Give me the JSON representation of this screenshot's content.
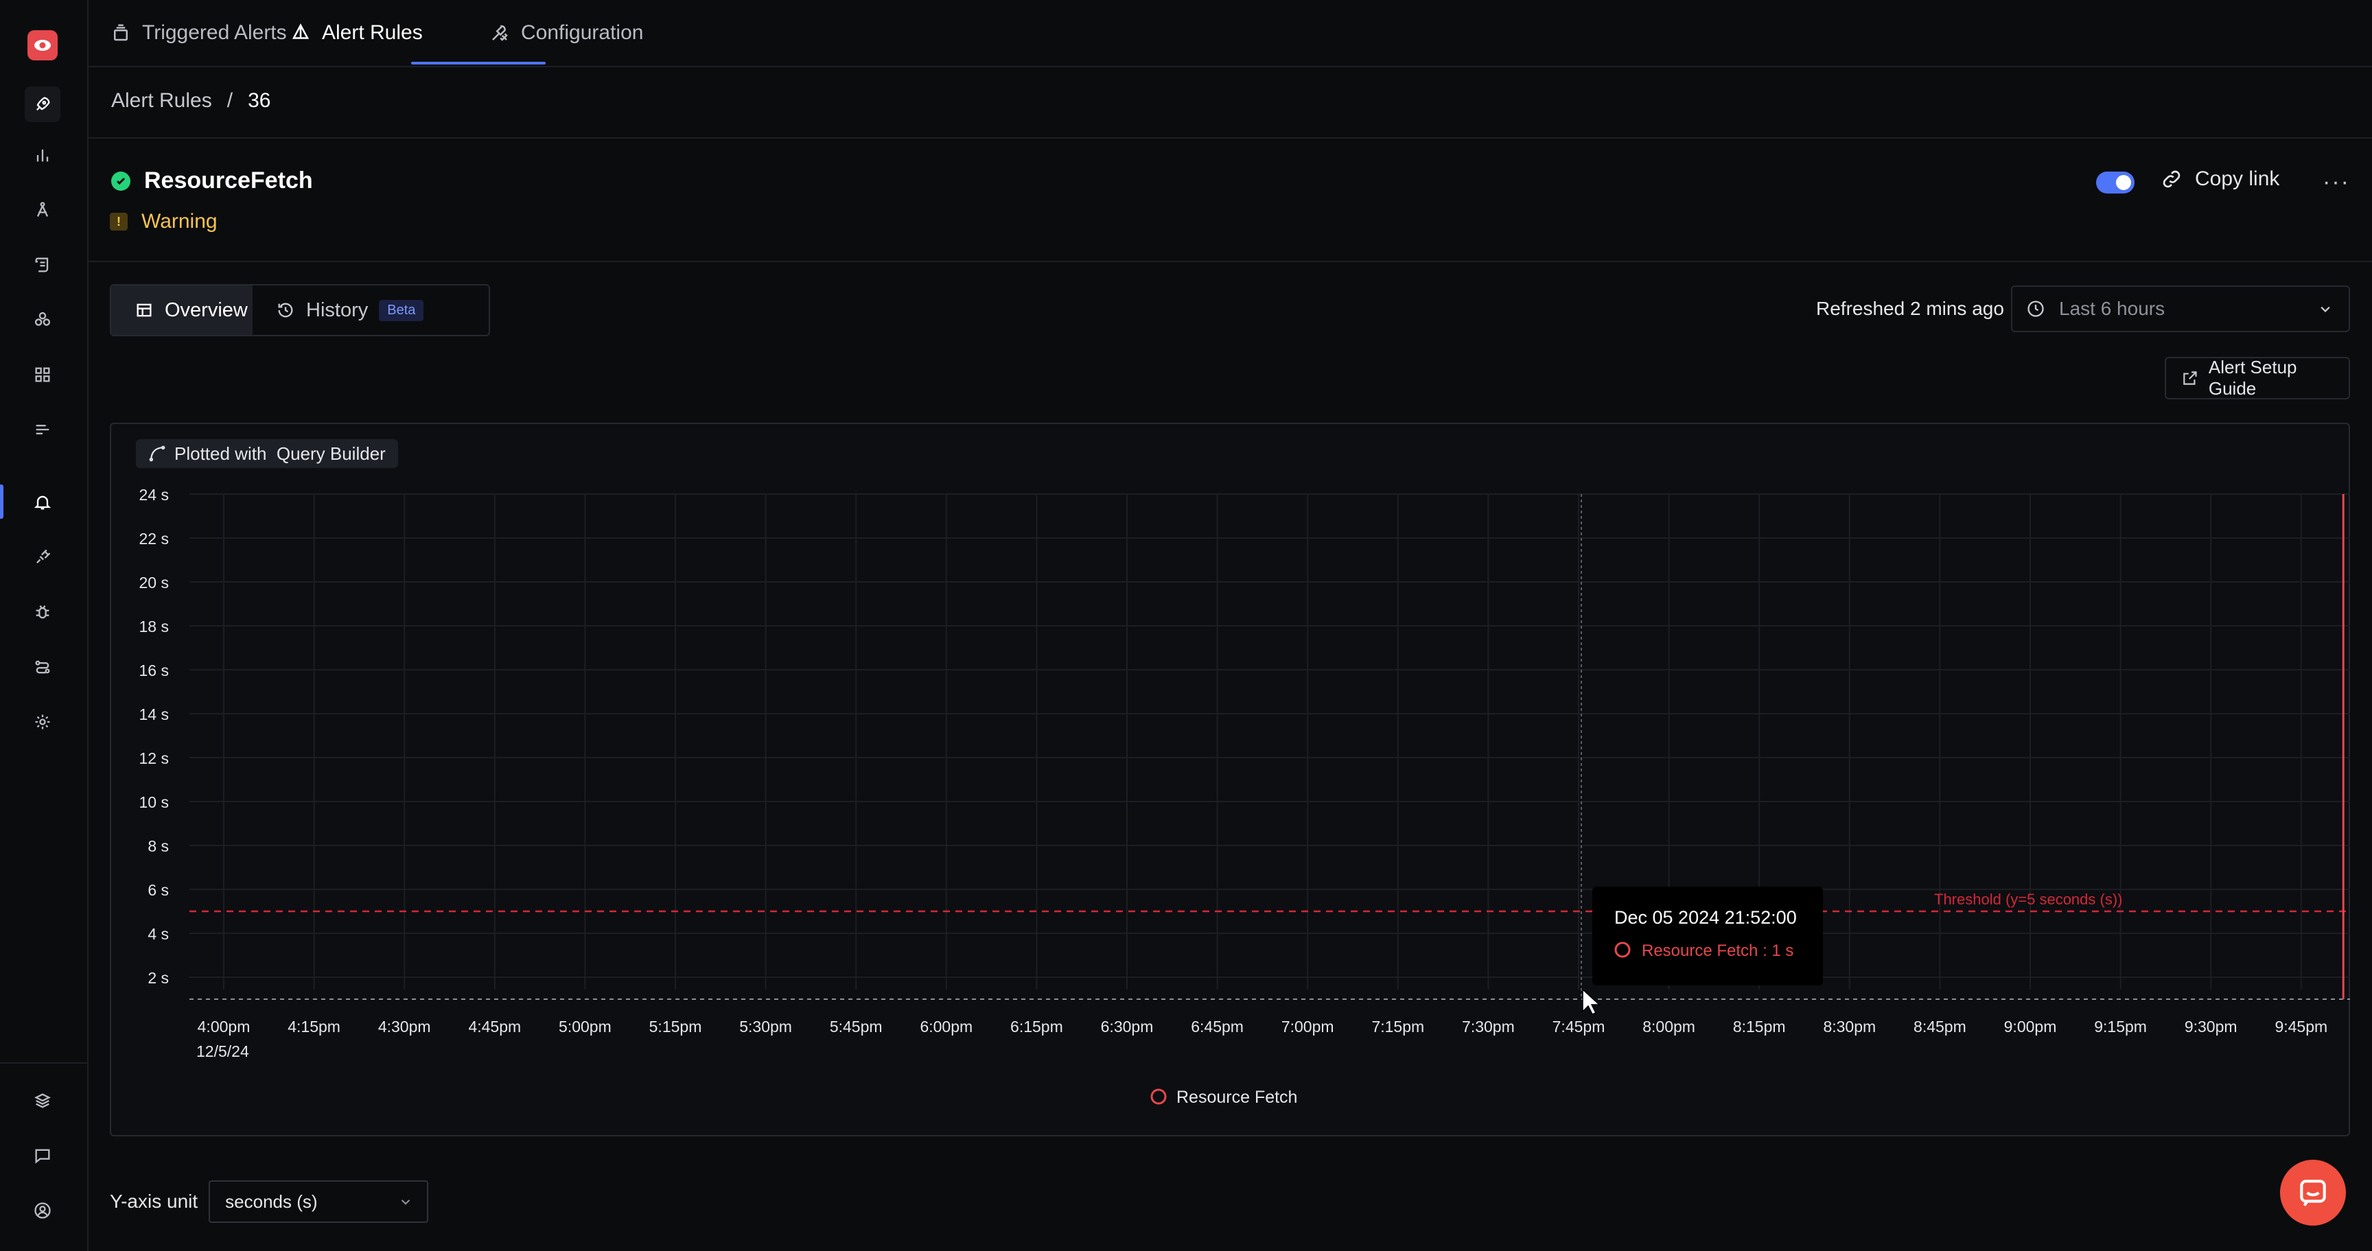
{
  "nav": {
    "tabs": [
      {
        "label": "Triggered Alerts",
        "icon": "stack-icon",
        "active": false
      },
      {
        "label": "Alert Rules",
        "icon": "alert-triangle-icon",
        "active": true
      },
      {
        "label": "Configuration",
        "icon": "tools-icon",
        "active": false
      }
    ]
  },
  "breadcrumb": {
    "parent": "Alert Rules",
    "sep": "/",
    "current": "36"
  },
  "alert": {
    "name": "ResourceFetch",
    "severity": "Warning",
    "severity_glyph": "!",
    "enabled": true,
    "copy_link_label": "Copy link",
    "more_label": "···"
  },
  "view_tabs": {
    "overview": "Overview",
    "history": "History",
    "history_badge": "Beta"
  },
  "refreshed_text": "Refreshed 2 mins ago",
  "time_range": "Last 6 hours",
  "setup_guide_label": "Alert Setup Guide",
  "plotted_label": "Plotted with  Query Builder",
  "colors": {
    "accent": "#4e74f8",
    "series": "#e5484d",
    "threshold": "#d3283a",
    "ok": "#25d37a",
    "warning": "#f5c451"
  },
  "chart_data": {
    "type": "line",
    "x_ticks": [
      "4:00pm",
      "4:15pm",
      "4:30pm",
      "4:45pm",
      "5:00pm",
      "5:15pm",
      "5:30pm",
      "5:45pm",
      "6:00pm",
      "6:15pm",
      "6:30pm",
      "6:45pm",
      "7:00pm",
      "7:15pm",
      "7:30pm",
      "7:45pm",
      "8:00pm",
      "8:15pm",
      "8:30pm",
      "8:45pm",
      "9:00pm",
      "9:15pm",
      "9:30pm",
      "9:45pm"
    ],
    "x_date_label": "12/5/24",
    "y_ticks": [
      "24 s",
      "22 s",
      "20 s",
      "18 s",
      "16 s",
      "14 s",
      "12 s",
      "10 s",
      "8 s",
      "6 s",
      "4 s",
      "2 s"
    ],
    "ylim": [
      1,
      24
    ],
    "series": [
      {
        "name": "Resource Fetch",
        "points": [
          {
            "x": "21:52",
            "y": 1
          },
          {
            "x": "21:52",
            "y": 24
          }
        ]
      }
    ],
    "threshold": {
      "value": 5,
      "label": "Threshold (y=5 seconds (s))"
    },
    "tooltip": {
      "time": "Dec 05 2024 21:52:00",
      "text": "Resource Fetch : 1 s"
    },
    "legend": "Resource Fetch"
  },
  "y_axis_unit": {
    "label": "Y-axis unit",
    "value": "seconds (s)"
  }
}
